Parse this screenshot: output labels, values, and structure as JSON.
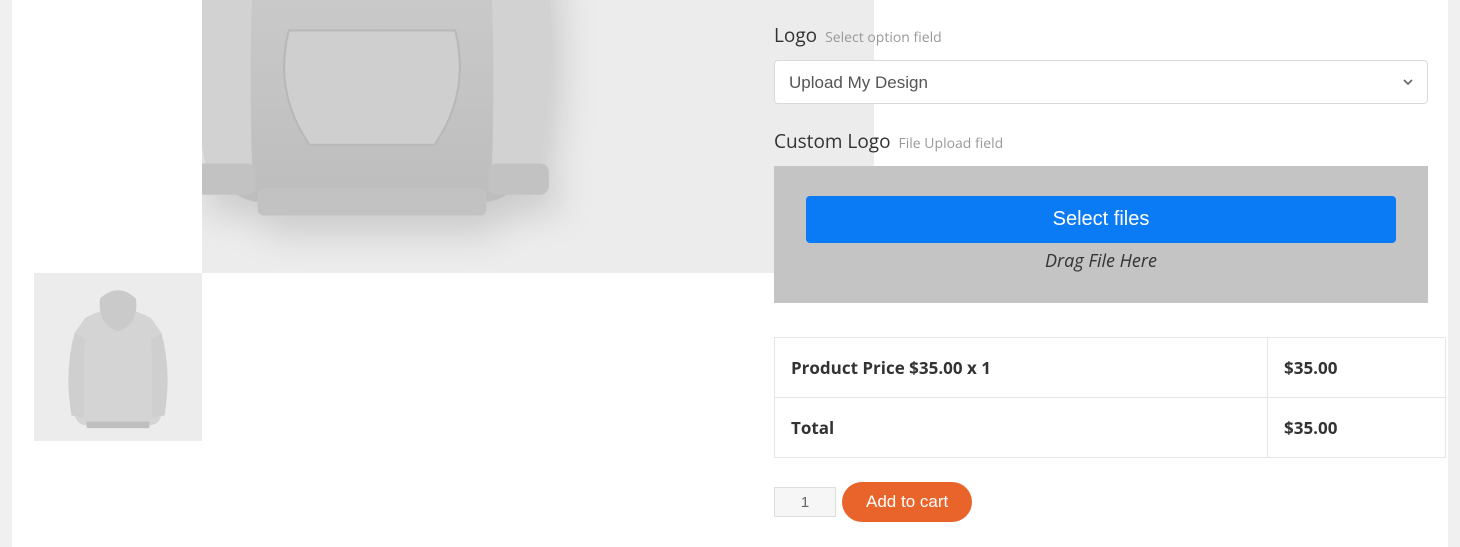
{
  "options": {
    "logo": {
      "label": "Logo",
      "hint": "Select option field",
      "selected": "Upload My Design"
    },
    "custom_logo": {
      "label": "Custom Logo",
      "hint": "File Upload field",
      "select_files": "Select files",
      "drag_hint": "Drag File Here"
    }
  },
  "pricing": {
    "product_price_label": "Product Price $35.00 x 1",
    "product_price_value": "$35.00",
    "total_label": "Total",
    "total_value": "$35.00"
  },
  "cart": {
    "quantity": "1",
    "add_label": "Add to cart"
  }
}
